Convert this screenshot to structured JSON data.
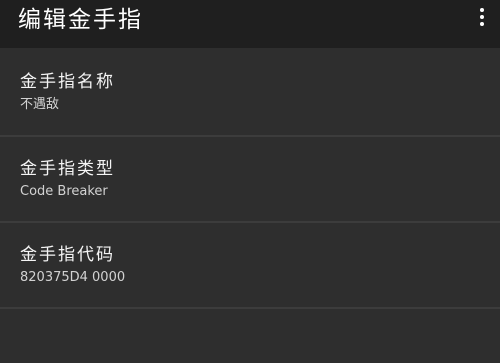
{
  "app_bar": {
    "title": "编辑金手指",
    "overflow_icon": "more-vert-icon"
  },
  "fields": [
    {
      "label": "金手指名称",
      "value": "不遇敌"
    },
    {
      "label": "金手指类型",
      "value": "Code Breaker"
    },
    {
      "label": "金手指代码",
      "value": "820375D4 0000"
    }
  ],
  "colors": {
    "app_bar_bg": "#1f1f1f",
    "content_bg": "#2e2e2e",
    "divider": "#3c3c3c",
    "primary_text": "#f4f4f4",
    "secondary_text": "#d2d2d2"
  }
}
